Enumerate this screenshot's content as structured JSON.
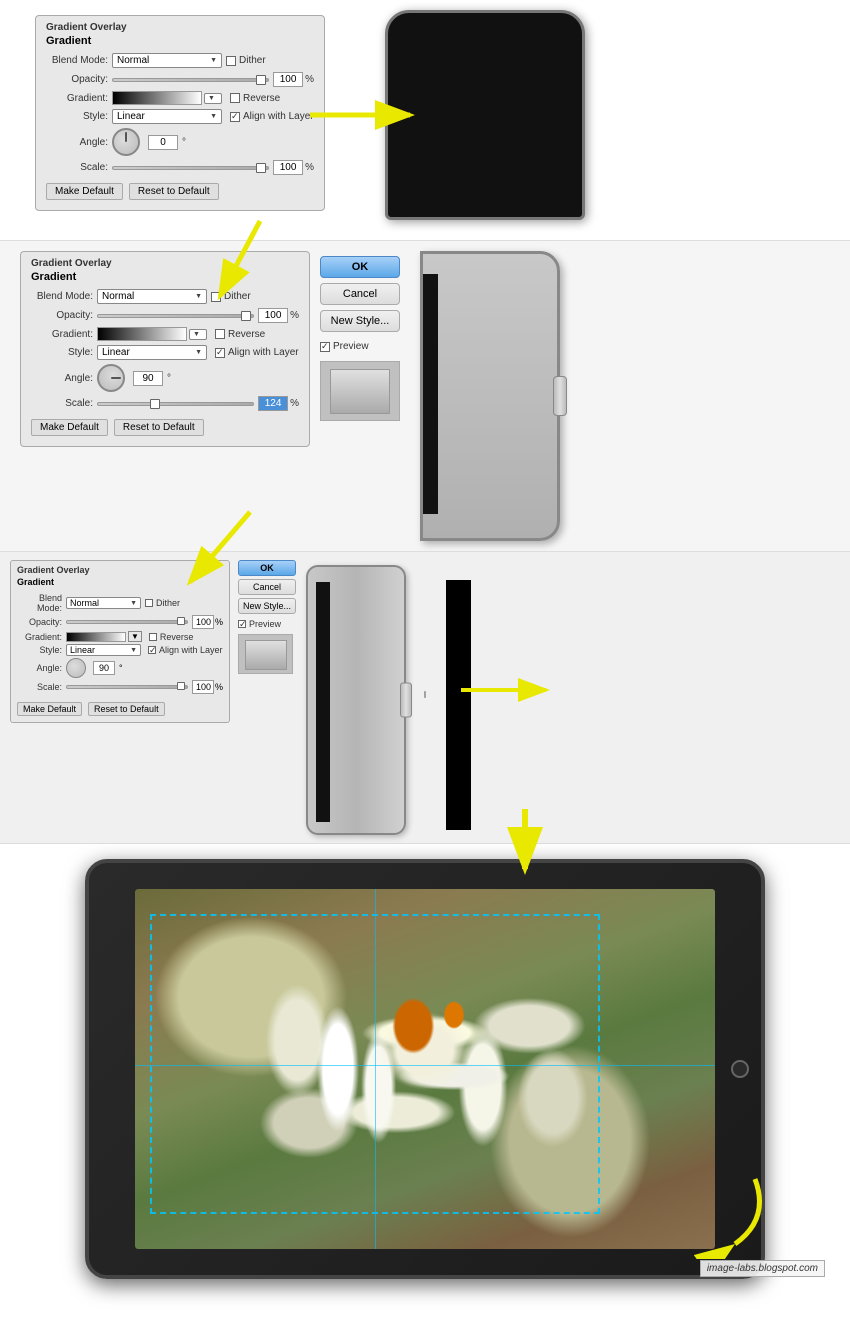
{
  "section1": {
    "panel": {
      "title": "Gradient Overlay",
      "subtitle": "Gradient",
      "blend_mode_label": "Blend Mode:",
      "blend_mode_value": "Normal",
      "dither_label": "Dither",
      "opacity_label": "Opacity:",
      "opacity_value": "100",
      "opacity_unit": "%",
      "gradient_label": "Gradient:",
      "reverse_label": "Reverse",
      "style_label": "Style:",
      "style_value": "Linear",
      "align_with_layer_label": "Align with Layer",
      "angle_label": "Angle:",
      "angle_value": "0",
      "angle_unit": "°",
      "scale_label": "Scale:",
      "scale_value": "100",
      "scale_unit": "%",
      "make_default_btn": "Make Default",
      "reset_to_default_btn": "Reset to Default"
    }
  },
  "section2": {
    "panel": {
      "title": "Gradient Overlay",
      "subtitle": "Gradient",
      "blend_mode_label": "Blend Mode:",
      "blend_mode_value": "Normal",
      "dither_label": "Dither",
      "opacity_label": "Opacity:",
      "opacity_value": "100",
      "opacity_unit": "%",
      "gradient_label": "Gradient:",
      "reverse_label": "Reverse",
      "style_label": "Style:",
      "style_value": "Linear",
      "align_with_layer_label": "Align with Layer",
      "angle_label": "Angle:",
      "angle_value": "90",
      "angle_unit": "°",
      "scale_label": "Scale:",
      "scale_value": "124",
      "scale_unit": "%",
      "make_default_btn": "Make Default",
      "reset_to_default_btn": "Reset to Default"
    },
    "ok_btn": "OK",
    "cancel_btn": "Cancel",
    "new_style_btn": "New Style...",
    "preview_label": "Preview"
  },
  "section3": {
    "panel": {
      "title": "Gradient Overlay",
      "subtitle": "Gradient",
      "blend_mode_label": "Blend Mode:",
      "blend_mode_value": "Normal",
      "dither_label": "Dither",
      "opacity_label": "Opacity:",
      "opacity_value": "100",
      "opacity_unit": "%",
      "gradient_label": "Gradient:",
      "reverse_label": "Reverse",
      "style_label": "Style:",
      "style_value": "Linear",
      "align_with_layer_label": "Align with Layer",
      "angle_label": "Angle:",
      "angle_value": "90",
      "angle_unit": "°",
      "scale_label": "Scale:",
      "scale_value": "100",
      "scale_unit": "%",
      "make_default_btn": "Make Default",
      "reset_to_default_btn": "Reset to Default"
    },
    "ok_btn": "OK",
    "cancel_btn": "Cancel",
    "new_style_btn": "New Style...",
    "preview_label": "Preview"
  },
  "section4": {
    "watermark": "image-labs.blogspot.com"
  },
  "arrows": {
    "right": "→",
    "down": "↓",
    "down_left": "↙"
  }
}
